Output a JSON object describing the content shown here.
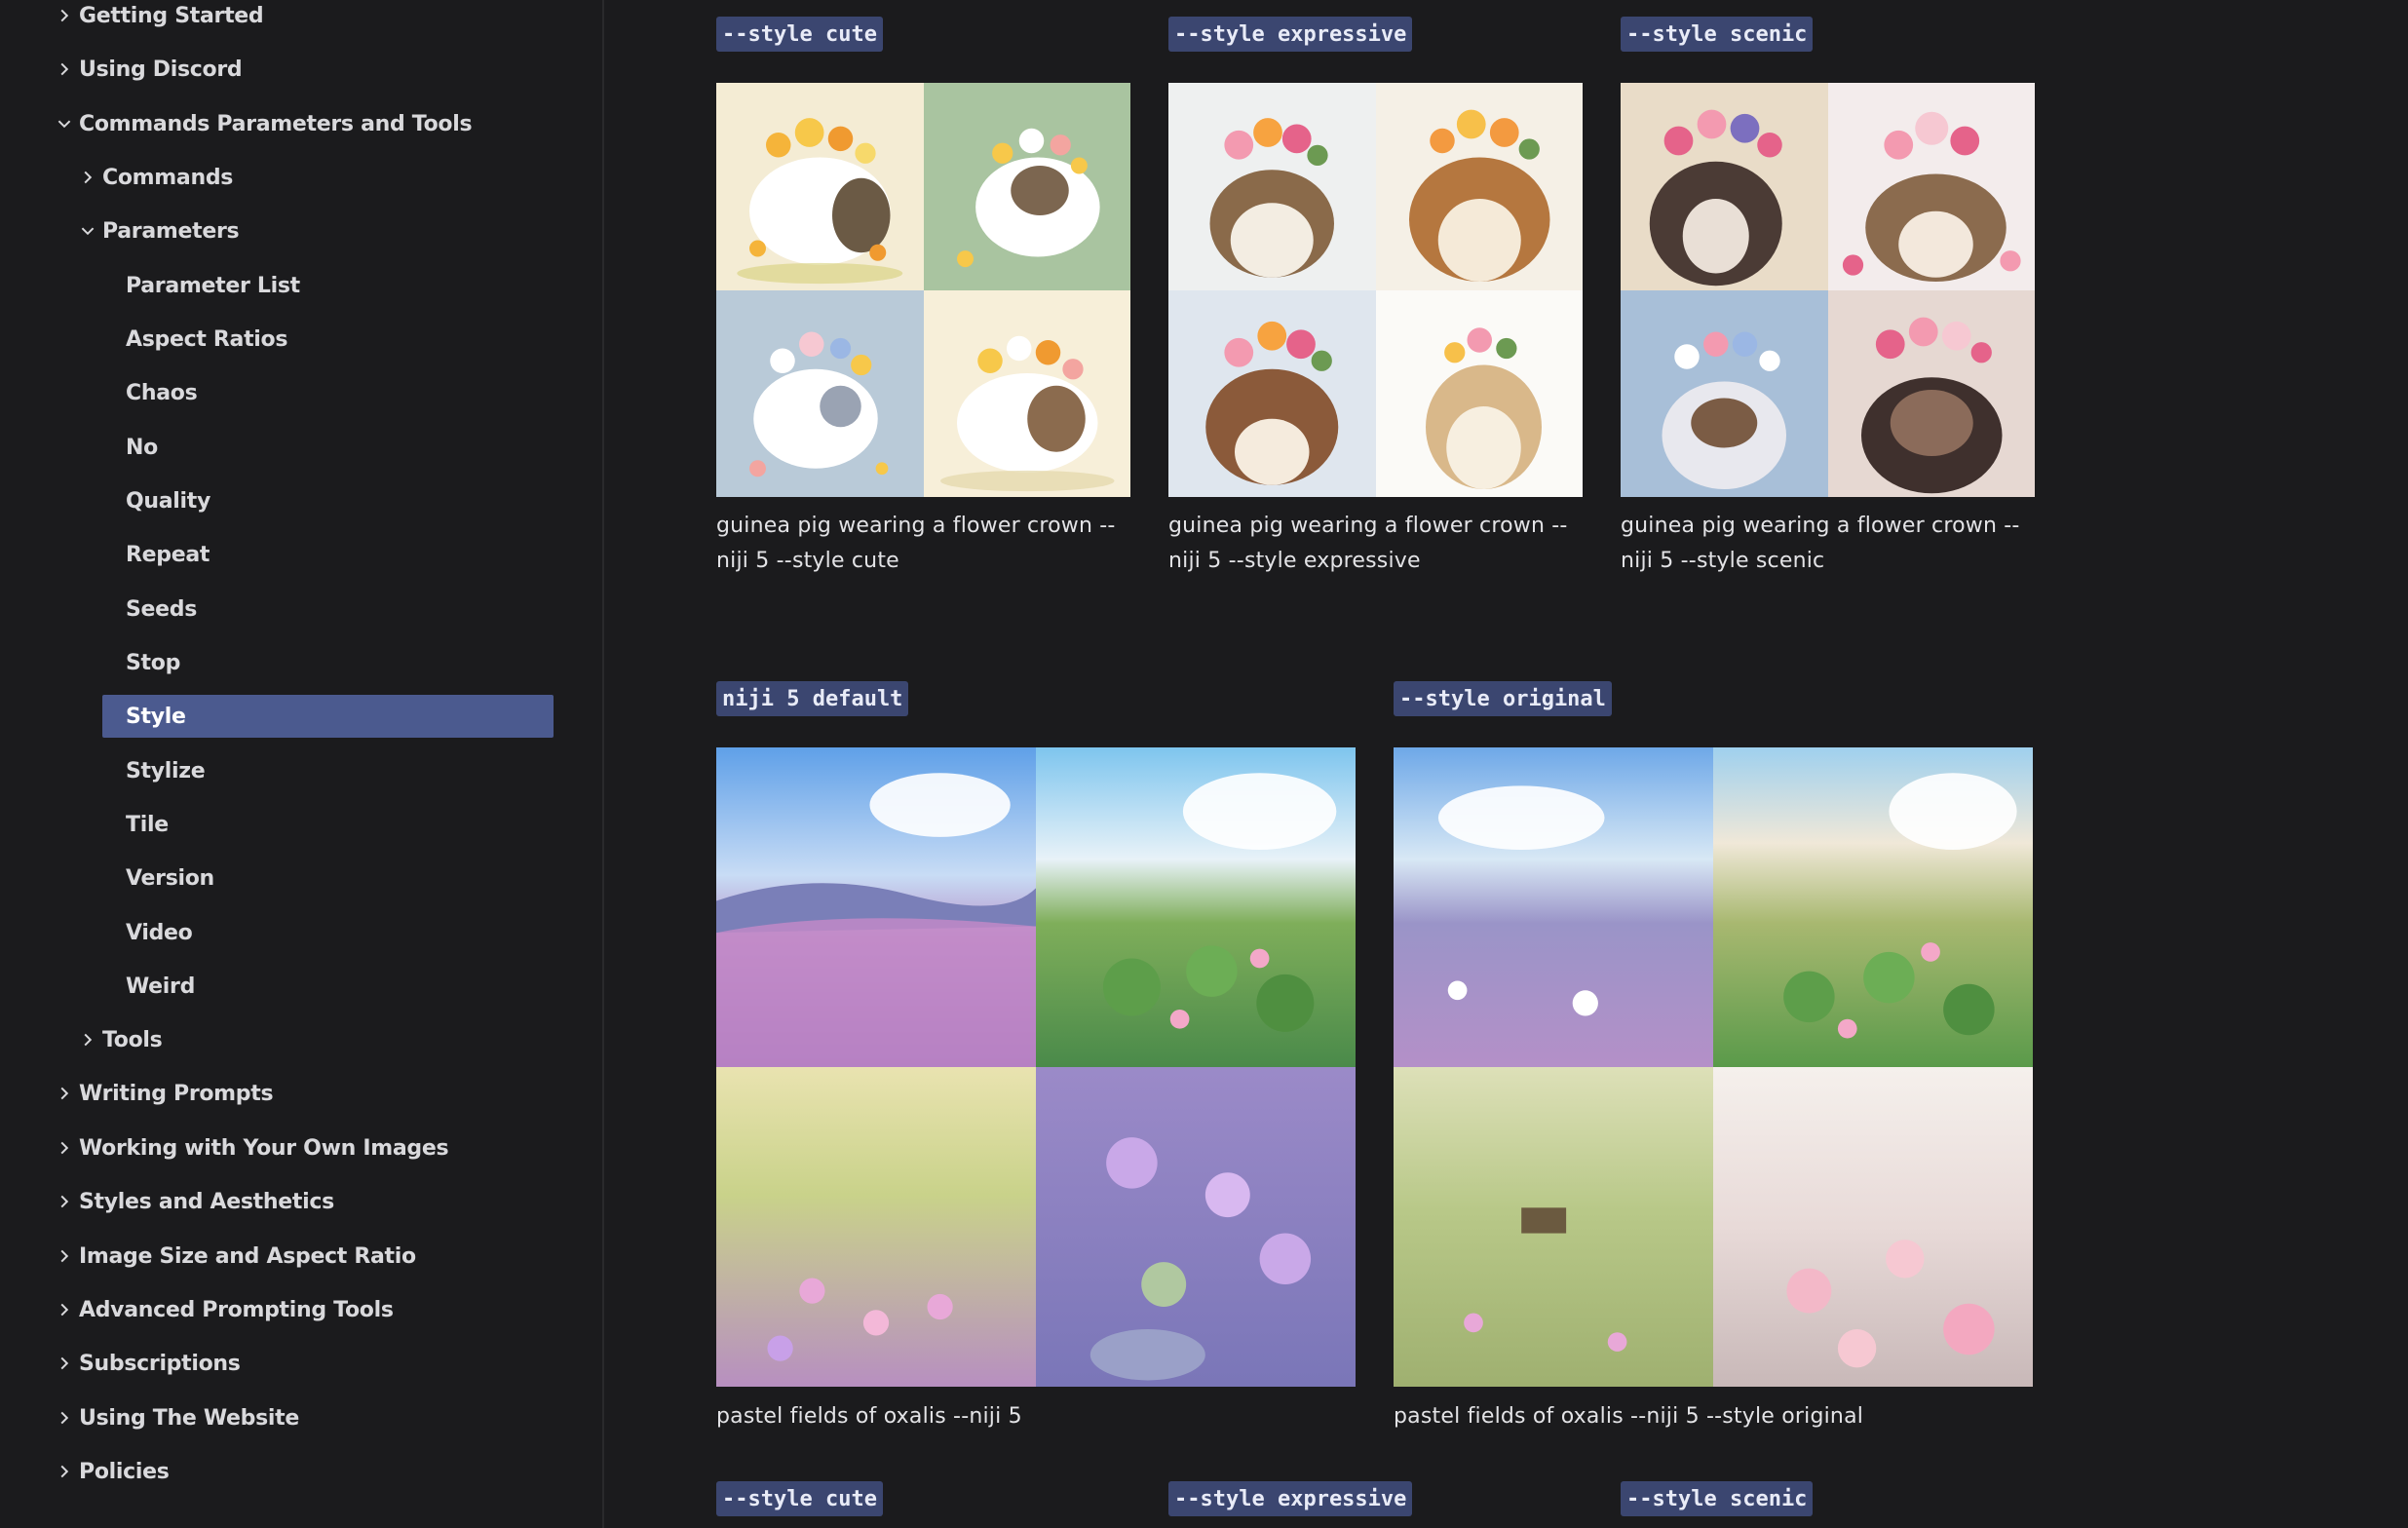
{
  "sidebar": {
    "items": [
      {
        "label": "Getting Started",
        "chevron": "right"
      },
      {
        "label": "Using Discord",
        "chevron": "right"
      },
      {
        "label": "Commands Parameters and Tools",
        "chevron": "down"
      },
      {
        "label": "Commands",
        "chevron": "right"
      },
      {
        "label": "Parameters",
        "chevron": "down"
      },
      {
        "label": "Parameter List"
      },
      {
        "label": "Aspect Ratios"
      },
      {
        "label": "Chaos"
      },
      {
        "label": "No"
      },
      {
        "label": "Quality"
      },
      {
        "label": "Repeat"
      },
      {
        "label": "Seeds"
      },
      {
        "label": "Stop"
      },
      {
        "label": "Style",
        "active": true
      },
      {
        "label": "Stylize"
      },
      {
        "label": "Tile"
      },
      {
        "label": "Version"
      },
      {
        "label": "Video"
      },
      {
        "label": "Weird"
      },
      {
        "label": "Tools",
        "chevron": "right"
      },
      {
        "label": "Writing Prompts",
        "chevron": "right"
      },
      {
        "label": "Working with Your Own Images",
        "chevron": "right"
      },
      {
        "label": "Styles and Aesthetics",
        "chevron": "right"
      },
      {
        "label": "Image Size and Aspect Ratio",
        "chevron": "right"
      },
      {
        "label": "Advanced Prompting Tools",
        "chevron": "right"
      },
      {
        "label": "Subscriptions",
        "chevron": "right"
      },
      {
        "label": "Using The Website",
        "chevron": "right"
      },
      {
        "label": "Policies",
        "chevron": "right"
      }
    ]
  },
  "main": {
    "row1": [
      {
        "tag": "--style cute",
        "caption_line1": "guinea pig wearing a flower crown --",
        "caption_line2": "niji 5 --style cute",
        "image_subject": "guinea pig with flower crown, cute style"
      },
      {
        "tag": "--style expressive",
        "caption_line1": "guinea pig wearing a flower crown --",
        "caption_line2": "niji 5 --style expressive",
        "image_subject": "guinea pig with flower crown, expressive style"
      },
      {
        "tag": "--style scenic",
        "caption_line1": "guinea pig wearing a flower crown --",
        "caption_line2": "niji 5 --style scenic",
        "image_subject": "guinea pig with flower crown, scenic style"
      }
    ],
    "row2": [
      {
        "tag": "niji 5 default",
        "caption": "pastel fields of oxalis --niji 5",
        "image_subject": "pastel fields of oxalis"
      },
      {
        "tag": "--style original",
        "caption": "pastel fields of oxalis --niji 5 --style original",
        "image_subject": "pastel fields of oxalis, original style"
      }
    ],
    "row3": [
      {
        "tag": "--style cute"
      },
      {
        "tag": "--style expressive"
      },
      {
        "tag": "--style scenic"
      }
    ]
  },
  "colors": {
    "background": "#1b1b1d",
    "sidebar_text": "#d9d9dc",
    "active_item": "#4b5a8f",
    "code_tag_bg": "#3b4670",
    "caption_text": "#e3e3e6"
  },
  "icons": {
    "chevron_right": "chevron-right-icon",
    "chevron_down": "chevron-down-icon"
  }
}
